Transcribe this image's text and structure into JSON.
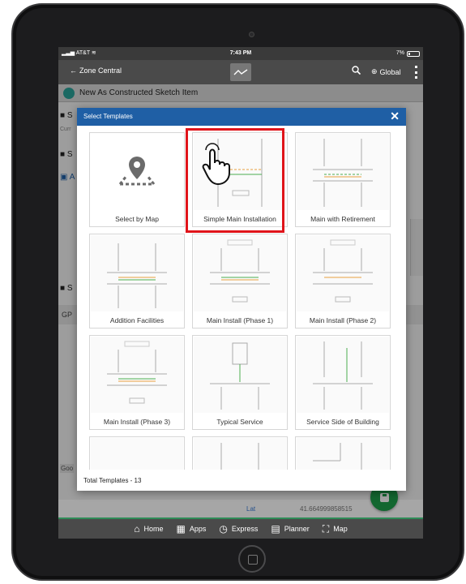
{
  "status_bar": {
    "carrier": "AT&T",
    "time": "7:43 PM",
    "battery": "7%"
  },
  "top_bar": {
    "back_label": "Zone Central",
    "global_label": "Global"
  },
  "page": {
    "header_title": "New As Constructed Sketch Item",
    "bg_items": [
      "S",
      "Curr",
      "S",
      "A",
      "S"
    ],
    "gp_label": "GP",
    "lat_label": "Lat",
    "lat_value": "41.664999858515",
    "google_label": "Goo"
  },
  "modal": {
    "title": "Select Templates",
    "close_label": "✕",
    "footer": "Total Templates - 13",
    "templates": [
      {
        "label": "Select by Map"
      },
      {
        "label": "Simple Main Installation"
      },
      {
        "label": "Main with Retirement"
      },
      {
        "label": "Addition Facilities"
      },
      {
        "label": "Main Install (Phase 1)"
      },
      {
        "label": "Main Install (Phase 2)"
      },
      {
        "label": "Main Install (Phase 3)"
      },
      {
        "label": "Typical Service"
      },
      {
        "label": "Service Side of Building"
      },
      {
        "label": ""
      },
      {
        "label": ""
      },
      {
        "label": ""
      }
    ]
  },
  "bottom_nav": [
    {
      "label": "Home",
      "icon": "home-icon"
    },
    {
      "label": "Apps",
      "icon": "apps-icon"
    },
    {
      "label": "Express",
      "icon": "stopwatch-icon"
    },
    {
      "label": "Planner",
      "icon": "calendar-icon"
    },
    {
      "label": "Map",
      "icon": "map-icon"
    }
  ]
}
